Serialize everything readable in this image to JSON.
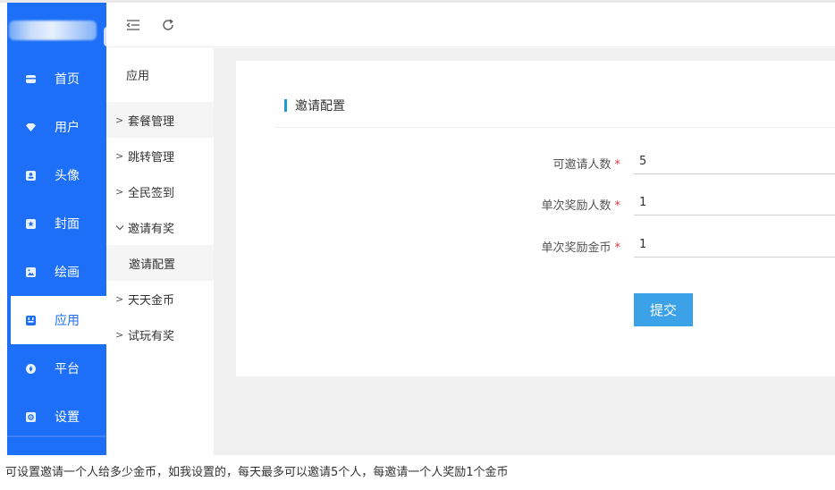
{
  "sidebar": {
    "items": [
      {
        "label": "首页",
        "icon": "home-icon"
      },
      {
        "label": "用户",
        "icon": "diamond-icon"
      },
      {
        "label": "头像",
        "icon": "portrait-icon"
      },
      {
        "label": "封面",
        "icon": "star-box-icon"
      },
      {
        "label": "绘画",
        "icon": "image-icon"
      },
      {
        "label": "应用",
        "icon": "app-icon",
        "active": true
      },
      {
        "label": "平台",
        "icon": "compass-icon"
      },
      {
        "label": "设置",
        "icon": "settings-icon"
      }
    ]
  },
  "toolbar": {
    "collapse_icon": "menu-collapse-icon",
    "refresh_icon": "refresh-icon"
  },
  "submenu": {
    "title": "应用",
    "items": [
      {
        "label": "套餐管理",
        "expanded": false
      },
      {
        "label": "跳转管理",
        "expanded": false
      },
      {
        "label": "全民签到",
        "expanded": false
      },
      {
        "label": "邀请有奖",
        "expanded": true
      },
      {
        "label": "邀请配置",
        "child": true,
        "active": true
      },
      {
        "label": "天天金币",
        "expanded": false
      },
      {
        "label": "试玩有奖",
        "expanded": false
      }
    ]
  },
  "form": {
    "title": "邀请配置",
    "fields": [
      {
        "label": "可邀请人数",
        "value": "5",
        "required": "*"
      },
      {
        "label": "单次奖励人数",
        "value": "1",
        "required": "*"
      },
      {
        "label": "单次奖励金币",
        "value": "1",
        "required": "*"
      }
    ],
    "submit_label": "提交"
  },
  "caption": "可设置邀请一个人给多少金币，如我设置的，每天最多可以邀请5个人，每邀请一个人奖励1个金币",
  "colors": {
    "sidebar": "#1c6ff6",
    "title_accent": "#1c9bd8",
    "submit": "#3ba2e8",
    "required": "#e4393c",
    "content_bg": "#f0f0f0"
  }
}
